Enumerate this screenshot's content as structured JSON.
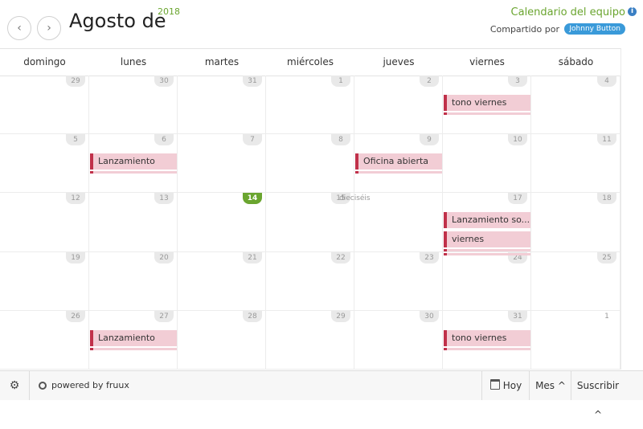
{
  "header": {
    "prev_label": "‹",
    "next_label": "›",
    "title": "Agosto de",
    "year": "2018",
    "calendar_name": "Calendario del equipo",
    "shared_label": "Compartido por",
    "owner": "Johnny Button"
  },
  "weekdays": [
    "domingo",
    "lunes",
    "martes",
    "miércoles",
    "jueves",
    "viernes",
    "sábado"
  ],
  "weeks": [
    [
      "29",
      "30",
      "31",
      "1",
      "2",
      "3",
      "4"
    ],
    [
      "5",
      "6",
      "7",
      "8",
      "9",
      "10",
      "11"
    ],
    [
      "12",
      "13",
      "14",
      "15",
      "dieciséis",
      "17",
      "18"
    ],
    [
      "19",
      "20",
      "21",
      "22",
      "23",
      "24",
      "25"
    ],
    [
      "26",
      "27",
      "28",
      "29",
      "30",
      "31",
      "1"
    ]
  ],
  "today": "14",
  "events": [
    {
      "title": "tono viernes",
      "week": 0,
      "day": 5,
      "slot": 0
    },
    {
      "title": "Lanzamiento",
      "week": 1,
      "day": 1,
      "slot": 0
    },
    {
      "title": "Oficina abierta",
      "week": 1,
      "day": 4,
      "slot": 0
    },
    {
      "title": "Lanzamiento so...",
      "week": 2,
      "day": 5,
      "slot": 0
    },
    {
      "title": "viernes",
      "week": 2,
      "day": 5,
      "slot": 1
    },
    {
      "title": "Lanzamiento",
      "week": 4,
      "day": 1,
      "slot": 0
    },
    {
      "title": "tono viernes",
      "week": 4,
      "day": 5,
      "slot": 0
    }
  ],
  "footer": {
    "powered_by": "powered by fruux",
    "today_label": "Hoy",
    "view_label": "Mes ^",
    "subscribe_label": "Suscribir ^"
  },
  "colors": {
    "accent": "#6aa52f",
    "event_bg": "#f2cdd5",
    "event_border": "#c0314a",
    "badge": "#3a9ad9"
  },
  "icons": [
    "chevron-left-icon",
    "chevron-right-icon",
    "info-icon",
    "gear-icon",
    "fruux-icon",
    "calendar-icon"
  ]
}
